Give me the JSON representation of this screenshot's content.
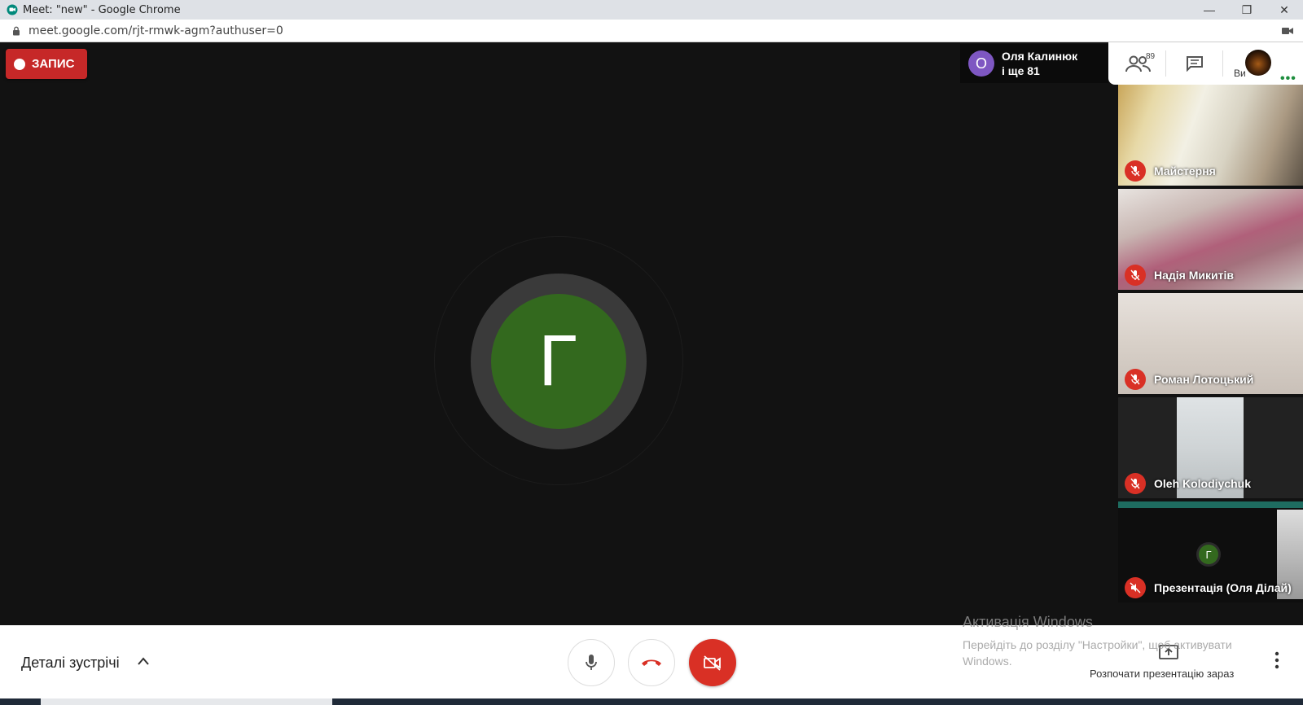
{
  "window": {
    "title": "Meet: \"new\" - Google Chrome",
    "url": "meet.google.com/rjt-rmwk-agm?authuser=0"
  },
  "recording": {
    "label": "ЗАПИС"
  },
  "main_speaker": {
    "initial": "Г",
    "color": "#33691e"
  },
  "participants_chip": {
    "initial": "O",
    "name": "Оля Калинюк",
    "more": "і ще 81"
  },
  "top_panel": {
    "people_count": "89",
    "self_label": "Ви"
  },
  "tiles": [
    {
      "name": "Майстерня",
      "muted": true
    },
    {
      "name": "Надія Микитів",
      "muted": true
    },
    {
      "name": "Роман Лотоцький",
      "muted": true
    },
    {
      "name": "Oleh Kolodiychuk",
      "muted": true
    },
    {
      "name": "Презентація (Оля Ділай)",
      "muted": true,
      "initial": "Г"
    }
  ],
  "bottom_bar": {
    "details_label": "Деталі зустрічі",
    "present_label": "Розпочати презентацію зараз"
  },
  "watermark": {
    "title": "Активація Windows",
    "subtitle": "Перейдіть до розділу \"Настройки\", щоб активувати Windows."
  },
  "colors": {
    "record_red": "#c62828",
    "danger_red": "#d93025",
    "avatar_green": "#33691e",
    "chip_purple": "#7e57c2",
    "accent_green": "#1e8e3e"
  }
}
